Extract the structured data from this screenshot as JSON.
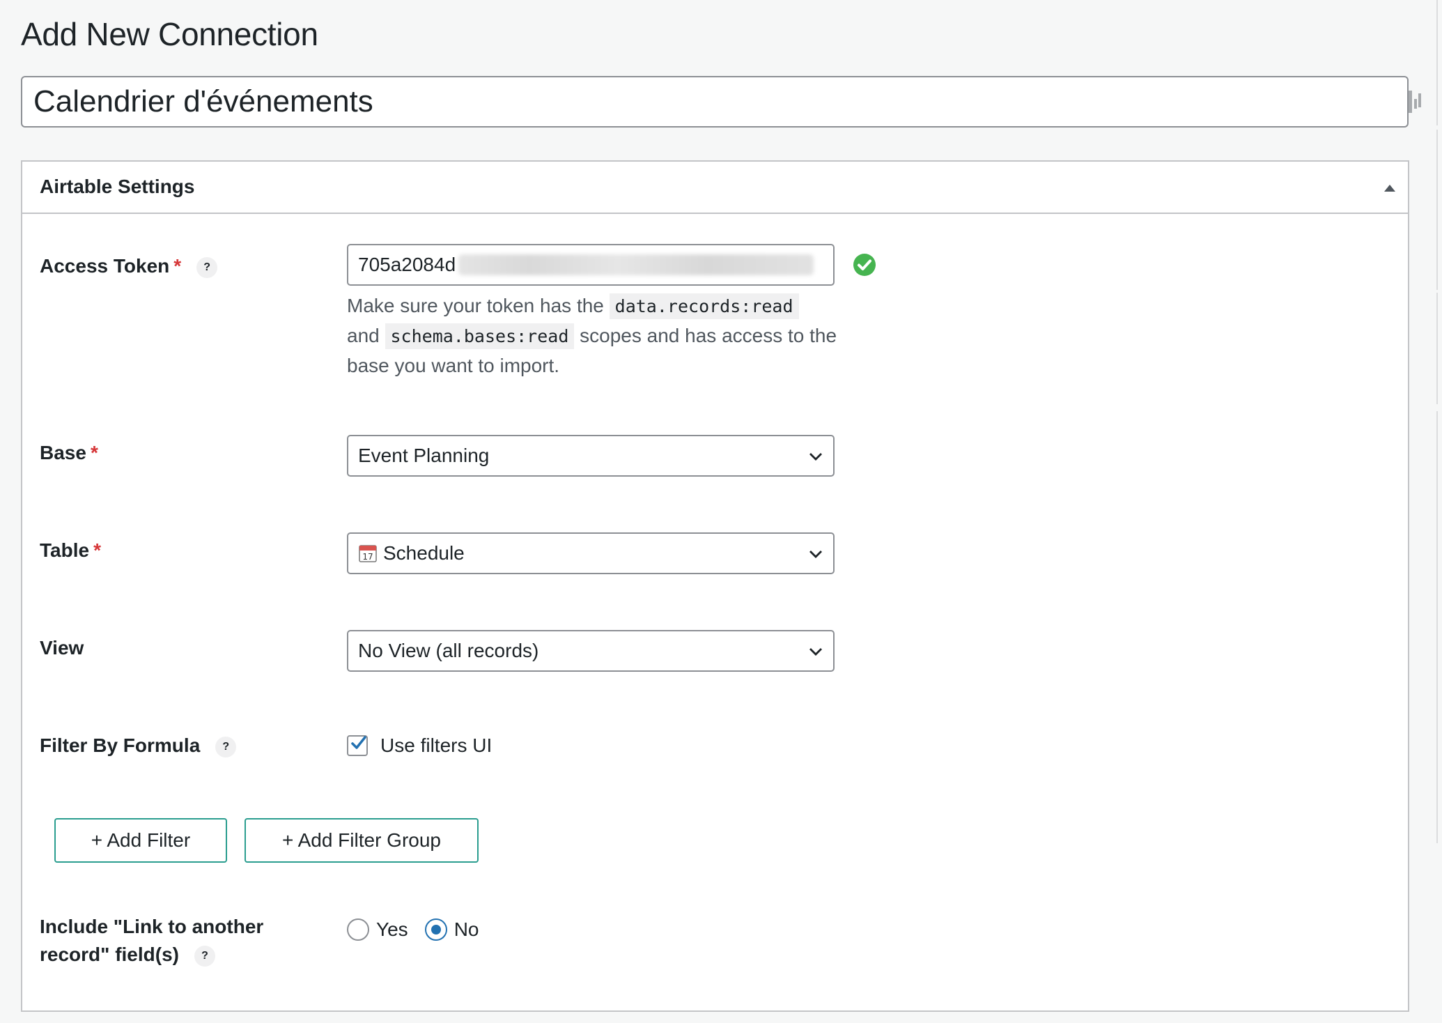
{
  "page": {
    "title": "Add New Connection",
    "connection_name": "Calendrier d'événements"
  },
  "panel": {
    "title": "Airtable Settings",
    "toggle_icon": "triangle-up-icon"
  },
  "access_token": {
    "label": "Access Token",
    "required_mark": "*",
    "help": "?",
    "value_visible": "705a2084d",
    "status_icon": "check-circle-icon",
    "status_color": "#46b450",
    "description": {
      "part1": "Make sure your token has the",
      "code1": "data.records:read",
      "part2": "and",
      "code2": "schema.bases:read",
      "part3": "scopes and has access to the base you want to import."
    }
  },
  "base": {
    "label": "Base",
    "required_mark": "*",
    "selected": "Event Planning"
  },
  "table": {
    "label": "Table",
    "required_mark": "*",
    "selected": "Schedule",
    "icon": "calendar-icon"
  },
  "view": {
    "label": "View",
    "selected": "No View (all records)"
  },
  "filter": {
    "label": "Filter By Formula",
    "help": "?",
    "checkbox_label": "Use filters UI",
    "checked": true,
    "add_filter": "+ Add Filter",
    "add_filter_group": "+ Add Filter Group"
  },
  "link_records": {
    "label_line1": "Include \"Link to another",
    "label_line2": "record\" field(s)",
    "help": "?",
    "options": [
      "Yes",
      "No"
    ],
    "selected": "No"
  },
  "colors": {
    "accent": "#2271b1",
    "button_border": "#2a9d8f",
    "required": "#d63638"
  }
}
